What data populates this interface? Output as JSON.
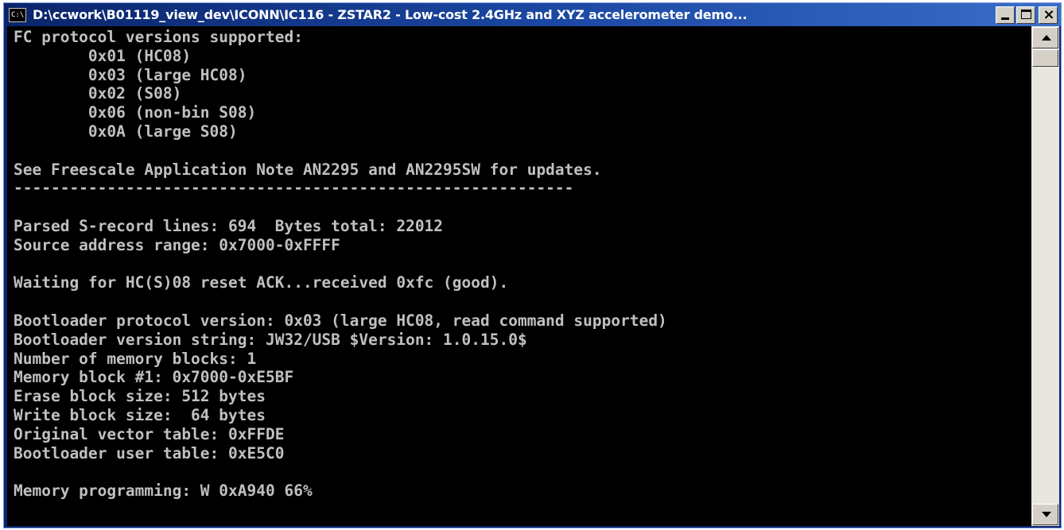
{
  "window": {
    "title": "D:\\ccwork\\B01119_view_dev\\ICONN\\IC116 - ZSTAR2 - Low-cost 2.4GHz and XYZ accelerometer demo...",
    "icon": "console-icon",
    "icon_text": "C:\\"
  },
  "console": {
    "text_color": "#c0c0c0",
    "background": "#000000",
    "lines": [
      "FC protocol versions supported:",
      "        0x01 (HC08)",
      "        0x03 (large HC08)",
      "        0x02 (S08)",
      "        0x06 (non-bin S08)",
      "        0x0A (large S08)",
      "",
      "See Freescale Application Note AN2295 and AN2295SW for updates.",
      "------------------------------------------------------------",
      "",
      "Parsed S-record lines: 694  Bytes total: 22012",
      "Source address range: 0x7000-0xFFFF",
      "",
      "Waiting for HC(S)08 reset ACK...received 0xfc (good).",
      "",
      "Bootloader protocol version: 0x03 (large HC08, read command supported)",
      "Bootloader version string: JW32/USB $Version: 1.0.15.0$",
      "Number of memory blocks: 1",
      "Memory block #1: 0x7000-0xE5BF",
      "Erase block size: 512 bytes",
      "Write block size:  64 bytes",
      "Original vector table: 0xFFDE",
      "Bootloader user table: 0xE5C0",
      "",
      "Memory programming: W 0xA940 66%"
    ]
  },
  "scrollbar": {
    "up_icon": "arrow-up-icon",
    "down_icon": "arrow-down-icon"
  }
}
